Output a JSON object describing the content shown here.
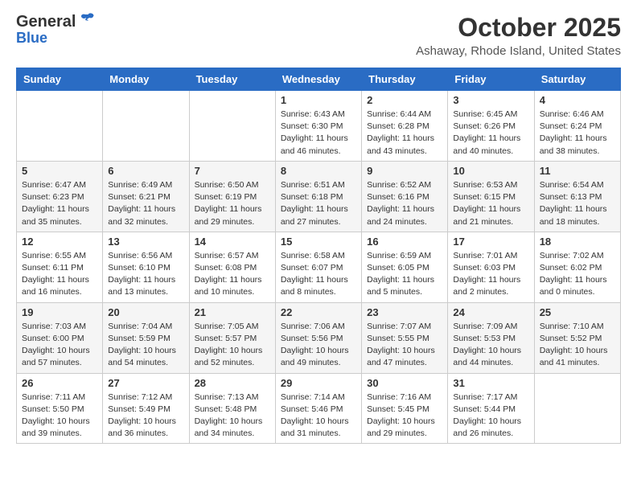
{
  "logo": {
    "general": "General",
    "blue": "Blue"
  },
  "header": {
    "month": "October 2025",
    "location": "Ashaway, Rhode Island, United States"
  },
  "weekdays": [
    "Sunday",
    "Monday",
    "Tuesday",
    "Wednesday",
    "Thursday",
    "Friday",
    "Saturday"
  ],
  "weeks": [
    [
      {
        "day": "",
        "info": ""
      },
      {
        "day": "",
        "info": ""
      },
      {
        "day": "",
        "info": ""
      },
      {
        "day": "1",
        "info": "Sunrise: 6:43 AM\nSunset: 6:30 PM\nDaylight: 11 hours\nand 46 minutes."
      },
      {
        "day": "2",
        "info": "Sunrise: 6:44 AM\nSunset: 6:28 PM\nDaylight: 11 hours\nand 43 minutes."
      },
      {
        "day": "3",
        "info": "Sunrise: 6:45 AM\nSunset: 6:26 PM\nDaylight: 11 hours\nand 40 minutes."
      },
      {
        "day": "4",
        "info": "Sunrise: 6:46 AM\nSunset: 6:24 PM\nDaylight: 11 hours\nand 38 minutes."
      }
    ],
    [
      {
        "day": "5",
        "info": "Sunrise: 6:47 AM\nSunset: 6:23 PM\nDaylight: 11 hours\nand 35 minutes."
      },
      {
        "day": "6",
        "info": "Sunrise: 6:49 AM\nSunset: 6:21 PM\nDaylight: 11 hours\nand 32 minutes."
      },
      {
        "day": "7",
        "info": "Sunrise: 6:50 AM\nSunset: 6:19 PM\nDaylight: 11 hours\nand 29 minutes."
      },
      {
        "day": "8",
        "info": "Sunrise: 6:51 AM\nSunset: 6:18 PM\nDaylight: 11 hours\nand 27 minutes."
      },
      {
        "day": "9",
        "info": "Sunrise: 6:52 AM\nSunset: 6:16 PM\nDaylight: 11 hours\nand 24 minutes."
      },
      {
        "day": "10",
        "info": "Sunrise: 6:53 AM\nSunset: 6:15 PM\nDaylight: 11 hours\nand 21 minutes."
      },
      {
        "day": "11",
        "info": "Sunrise: 6:54 AM\nSunset: 6:13 PM\nDaylight: 11 hours\nand 18 minutes."
      }
    ],
    [
      {
        "day": "12",
        "info": "Sunrise: 6:55 AM\nSunset: 6:11 PM\nDaylight: 11 hours\nand 16 minutes."
      },
      {
        "day": "13",
        "info": "Sunrise: 6:56 AM\nSunset: 6:10 PM\nDaylight: 11 hours\nand 13 minutes."
      },
      {
        "day": "14",
        "info": "Sunrise: 6:57 AM\nSunset: 6:08 PM\nDaylight: 11 hours\nand 10 minutes."
      },
      {
        "day": "15",
        "info": "Sunrise: 6:58 AM\nSunset: 6:07 PM\nDaylight: 11 hours\nand 8 minutes."
      },
      {
        "day": "16",
        "info": "Sunrise: 6:59 AM\nSunset: 6:05 PM\nDaylight: 11 hours\nand 5 minutes."
      },
      {
        "day": "17",
        "info": "Sunrise: 7:01 AM\nSunset: 6:03 PM\nDaylight: 11 hours\nand 2 minutes."
      },
      {
        "day": "18",
        "info": "Sunrise: 7:02 AM\nSunset: 6:02 PM\nDaylight: 11 hours\nand 0 minutes."
      }
    ],
    [
      {
        "day": "19",
        "info": "Sunrise: 7:03 AM\nSunset: 6:00 PM\nDaylight: 10 hours\nand 57 minutes."
      },
      {
        "day": "20",
        "info": "Sunrise: 7:04 AM\nSunset: 5:59 PM\nDaylight: 10 hours\nand 54 minutes."
      },
      {
        "day": "21",
        "info": "Sunrise: 7:05 AM\nSunset: 5:57 PM\nDaylight: 10 hours\nand 52 minutes."
      },
      {
        "day": "22",
        "info": "Sunrise: 7:06 AM\nSunset: 5:56 PM\nDaylight: 10 hours\nand 49 minutes."
      },
      {
        "day": "23",
        "info": "Sunrise: 7:07 AM\nSunset: 5:55 PM\nDaylight: 10 hours\nand 47 minutes."
      },
      {
        "day": "24",
        "info": "Sunrise: 7:09 AM\nSunset: 5:53 PM\nDaylight: 10 hours\nand 44 minutes."
      },
      {
        "day": "25",
        "info": "Sunrise: 7:10 AM\nSunset: 5:52 PM\nDaylight: 10 hours\nand 41 minutes."
      }
    ],
    [
      {
        "day": "26",
        "info": "Sunrise: 7:11 AM\nSunset: 5:50 PM\nDaylight: 10 hours\nand 39 minutes."
      },
      {
        "day": "27",
        "info": "Sunrise: 7:12 AM\nSunset: 5:49 PM\nDaylight: 10 hours\nand 36 minutes."
      },
      {
        "day": "28",
        "info": "Sunrise: 7:13 AM\nSunset: 5:48 PM\nDaylight: 10 hours\nand 34 minutes."
      },
      {
        "day": "29",
        "info": "Sunrise: 7:14 AM\nSunset: 5:46 PM\nDaylight: 10 hours\nand 31 minutes."
      },
      {
        "day": "30",
        "info": "Sunrise: 7:16 AM\nSunset: 5:45 PM\nDaylight: 10 hours\nand 29 minutes."
      },
      {
        "day": "31",
        "info": "Sunrise: 7:17 AM\nSunset: 5:44 PM\nDaylight: 10 hours\nand 26 minutes."
      },
      {
        "day": "",
        "info": ""
      }
    ]
  ]
}
